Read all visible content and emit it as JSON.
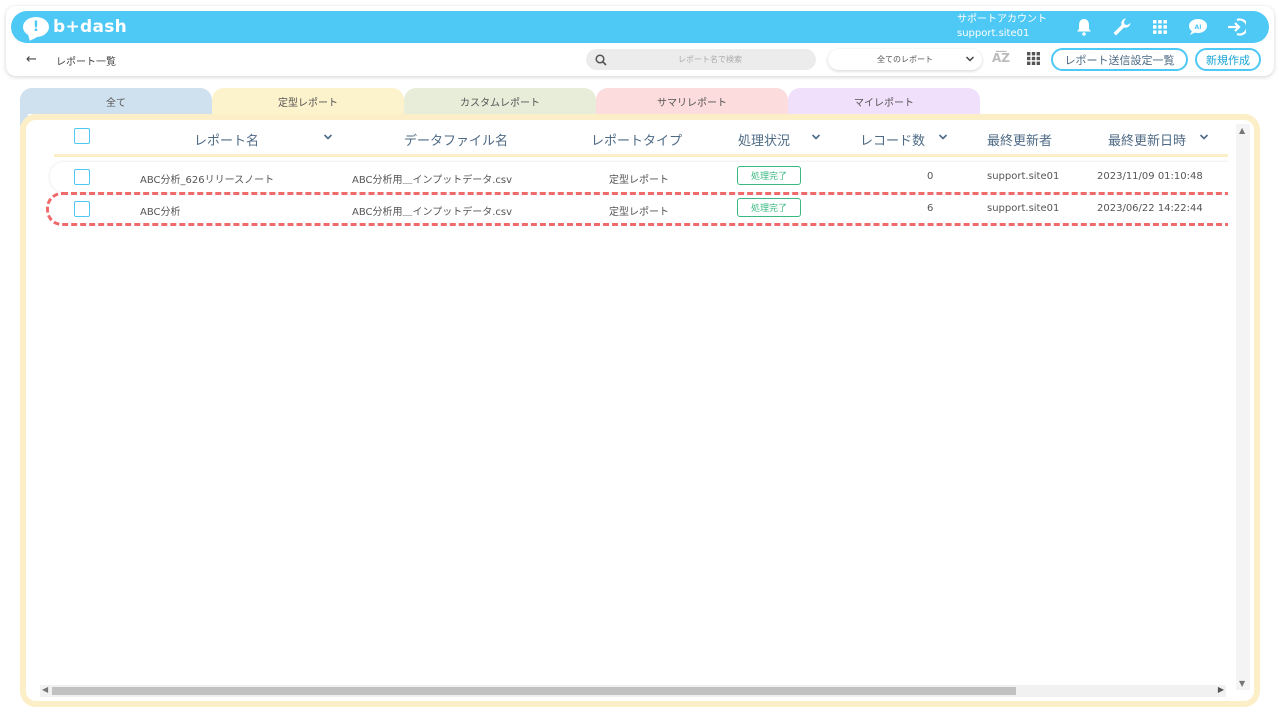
{
  "app": {
    "logo_text": "b+dash",
    "brand_color": "#4ec8f5"
  },
  "account": {
    "name": "サポートアカウント",
    "id": "support.site01"
  },
  "top_icons": [
    "bell-icon",
    "wrench-icon",
    "apps-grid-icon",
    "ai-assistant-icon",
    "logout-icon"
  ],
  "breadcrumb": {
    "back_icon": "arrow-left-icon",
    "title": "レポート一覧"
  },
  "search": {
    "placeholder": "レポート名で検索",
    "value": ""
  },
  "filter": {
    "selected": "全てのレポート"
  },
  "toolbar": {
    "send_settings_label": "レポート送信設定一覧",
    "new_label": "新規作成"
  },
  "tabs": [
    {
      "label": "全て",
      "color": "#cfe1ee"
    },
    {
      "label": "定型レポート",
      "color": "#fcf2cc"
    },
    {
      "label": "カスタムレポート",
      "color": "#e8edd9"
    },
    {
      "label": "サマリレポート",
      "color": "#fcdcdc"
    },
    {
      "label": "マイレポート",
      "color": "#f1e0fb"
    }
  ],
  "table": {
    "columns": [
      "レポート名",
      "データファイル名",
      "レポートタイプ",
      "処理状況",
      "レコード数",
      "最終更新者",
      "最終更新日時"
    ],
    "rows": [
      {
        "name": "ABC分析_626リリースノート",
        "file": "ABC分析用＿インプットデータ.csv",
        "type": "定型レポート",
        "status": "処理完了",
        "records": "0",
        "updated_by": "support.site01",
        "updated_at": "2023/11/09 01:10:48"
      },
      {
        "name": "ABC分析",
        "file": "ABC分析用＿インプットデータ.csv",
        "type": "定型レポート",
        "status": "処理完了",
        "records": "6",
        "updated_by": "support.site01",
        "updated_at": "2023/06/22 14:22:44"
      }
    ]
  },
  "status_color": "#39b97f",
  "highlight_color": "#ef6b6b"
}
